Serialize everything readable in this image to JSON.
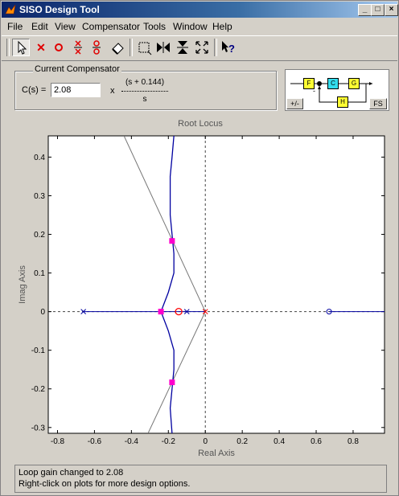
{
  "window": {
    "title": "SISO Design Tool"
  },
  "titlebar_buttons": [
    "_",
    "□",
    "×"
  ],
  "menu": [
    "File",
    "Edit",
    "View",
    "Compensator",
    "Tools",
    "Window",
    "Help"
  ],
  "toolbar": {
    "icons": [
      "arrow-select-icon",
      "add-pole-icon",
      "add-zero-icon",
      "add-complex-pole-icon",
      "add-complex-zero-icon",
      "eraser-icon",
      "zoom-box-icon",
      "zoom-x-icon",
      "zoom-y-icon",
      "fit-icon",
      "whats-this-icon"
    ]
  },
  "compensator": {
    "legend": "Current Compensator",
    "cs_label": "C(s) =",
    "gain_value": "2.08",
    "times": "x",
    "numerator": "(s + 0.144)",
    "denominator": "s"
  },
  "diagram": {
    "F": "F",
    "C": "C",
    "G": "G",
    "H": "H",
    "minus": "-",
    "pm_button": "+/-",
    "fs_button": "FS"
  },
  "plot": {
    "title": "Root Locus",
    "xlabel": "Real Axis",
    "ylabel": "Imag Axis"
  },
  "chart_data": {
    "type": "scatter",
    "title": "Root Locus",
    "xlabel": "Real Axis",
    "ylabel": "Imag Axis",
    "xlim": [
      -0.85,
      0.97
    ],
    "ylim": [
      -0.315,
      0.455
    ],
    "xticks": [
      "-0.8",
      "-0.6",
      "-0.4",
      "-0.2",
      "0",
      "0.2",
      "0.4",
      "0.6",
      "0.8"
    ],
    "xtick_values": [
      -0.8,
      -0.6,
      -0.4,
      -0.2,
      0,
      0.2,
      0.4,
      0.6,
      0.8
    ],
    "yticks": [
      "0.4",
      "0.3",
      "0.2",
      "0.1",
      "0",
      "-0.1",
      "-0.2",
      "-0.3"
    ],
    "ytick_values": [
      0.4,
      0.3,
      0.2,
      0.1,
      0,
      -0.1,
      -0.2,
      -0.3
    ],
    "open_loop_poles": [
      [
        -0.66,
        0
      ],
      [
        -0.1,
        0
      ],
      [
        0,
        0
      ]
    ],
    "open_loop_zeros": [
      [
        0.67,
        0
      ]
    ],
    "compensator_zero": [
      -0.144,
      0
    ],
    "closed_loop_poles": [
      [
        -0.24,
        0
      ],
      [
        -0.18,
        0.183
      ],
      [
        -0.18,
        -0.183
      ]
    ],
    "locus_branch_upper": [
      [
        -0.24,
        0
      ],
      [
        -0.2,
        0.05
      ],
      [
        -0.17,
        0.1
      ],
      [
        -0.17,
        0.15
      ],
      [
        -0.18,
        0.2
      ],
      [
        -0.19,
        0.25
      ],
      [
        -0.19,
        0.3
      ],
      [
        -0.19,
        0.35
      ],
      [
        -0.18,
        0.4
      ],
      [
        -0.17,
        0.455
      ]
    ],
    "locus_branch_lower": [
      [
        -0.24,
        0
      ],
      [
        -0.2,
        -0.05
      ],
      [
        -0.17,
        -0.1
      ],
      [
        -0.17,
        -0.15
      ],
      [
        -0.18,
        -0.2
      ],
      [
        -0.19,
        -0.25
      ],
      [
        -0.18,
        -0.315
      ]
    ],
    "asymptote_lines": [
      [
        [
          -0.44,
          0.455
        ],
        [
          0,
          0
        ]
      ],
      [
        [
          -0.31,
          -0.315
        ],
        [
          0,
          0
        ]
      ]
    ],
    "grid": false
  },
  "status": {
    "line1": "Loop gain changed to 2.08",
    "line2": "Right-click on plots for more design options."
  },
  "colors": {
    "locus": "#0000a0",
    "closed_loop": "#ff00cc",
    "pole_zero": "#ff0000",
    "title_bar": "#0a246a"
  }
}
